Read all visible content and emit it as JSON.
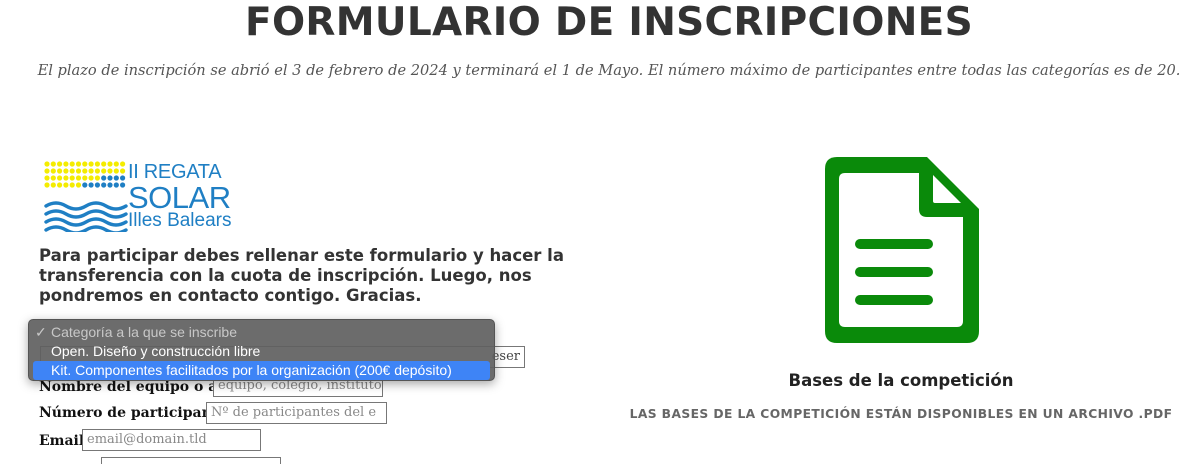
{
  "header": {
    "title": "FORMULARIO DE INSCRIPCIONES",
    "subtitle": "El plazo de inscripción se abrió el 3 de febrero de 2024 y terminará el 1 de Mayo. El número máximo de participantes entre todas las categorías es de 20."
  },
  "logo": {
    "line1": "II REGATA",
    "line2": "SOLAR",
    "line3": "Illes Balears",
    "colors": {
      "dots_yellow": "#f4ec00",
      "dots_blue": "#1f7fc4",
      "waves": "#1f7fc4"
    }
  },
  "form": {
    "intro": "Para participar debes rellenar este formulario y hacer la transferencia con la cuota de inscripción. Luego, nos pondremos en contacto contigo. Gracias.",
    "category_select": {
      "options": [
        {
          "label": "Categoría a la que se inscribe",
          "disabled": true,
          "selected": true
        },
        {
          "label": "Open. Diseño y construcción libre",
          "disabled": false,
          "selected": false
        },
        {
          "label": "Kit. Componentes facilitados por la organización (200€ depósito)",
          "disabled": false,
          "selected": false,
          "highlighted": true
        }
      ],
      "partial_behind_text": "eser"
    },
    "team_name": {
      "label": "Nombre del equipo o alias",
      "placeholder": "equipo, colegio, instituto"
    },
    "participants": {
      "label": "Número de participantes",
      "placeholder": "Nº de participantes del e"
    },
    "email": {
      "label": "Email",
      "placeholder": "email@domain.tld"
    }
  },
  "bases": {
    "title": "Bases de la competición",
    "description": "LAS BASES DE LA COMPETICIÓN ESTÁN DISPONIBLES EN UN ARCHIVO .PDF",
    "icon": "document-icon",
    "icon_color": "#0a8a0a"
  }
}
